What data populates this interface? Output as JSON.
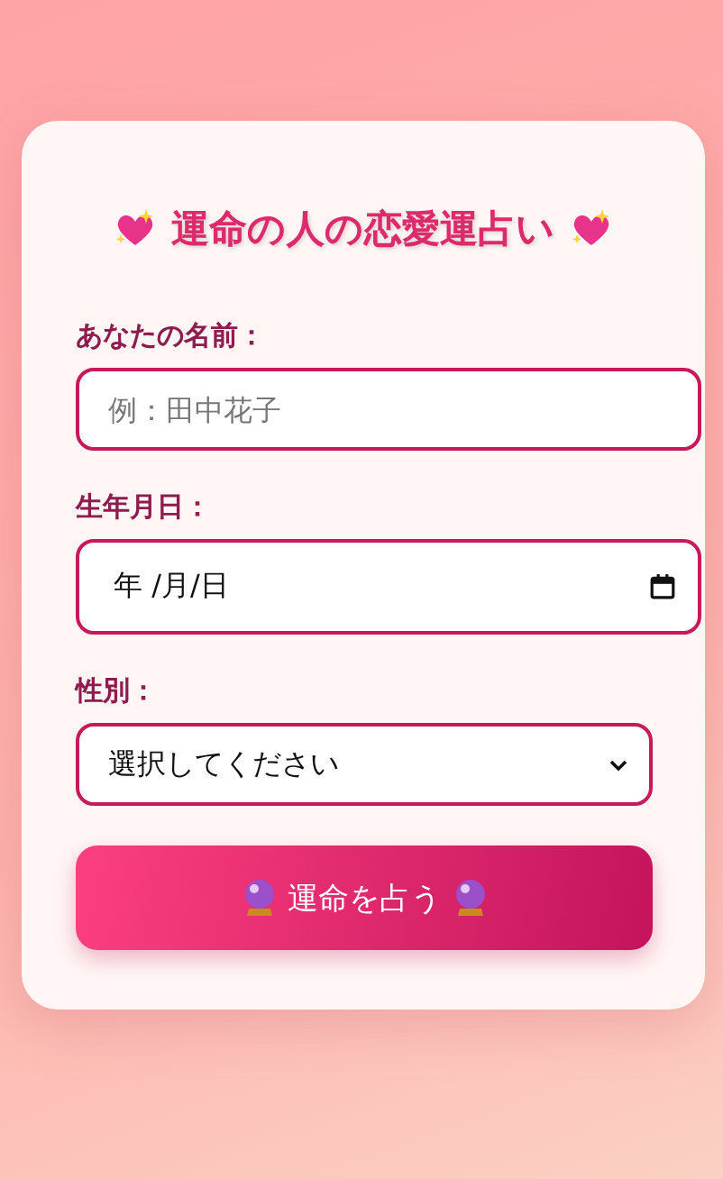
{
  "title": "運命の人の恋愛運占い",
  "fields": [
    {
      "kind": "text",
      "label": "あなたの名前：",
      "placeholder": "例：田中花子"
    },
    {
      "kind": "date",
      "label": "生年月日：",
      "value": "年 /月/日"
    },
    {
      "kind": "select",
      "label": "性別：",
      "value": "選択してください"
    }
  ],
  "submit_button": "運命を占う"
}
